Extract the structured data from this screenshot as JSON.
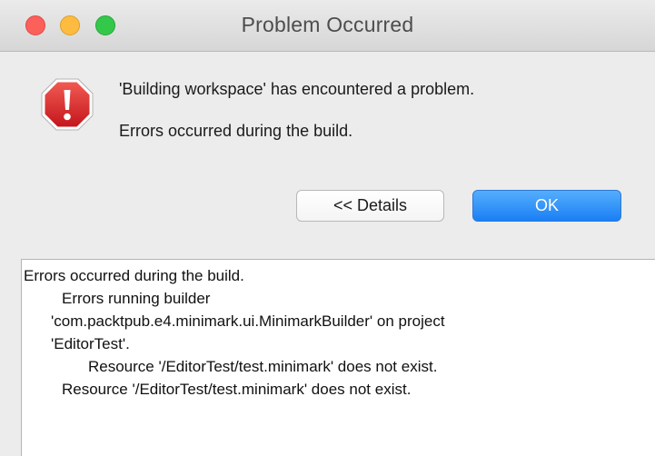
{
  "window": {
    "title": "Problem Occurred"
  },
  "colors": {
    "close": "#fc605b",
    "minimize": "#fdbc40",
    "zoom": "#34c84a",
    "accent": "#1a7ff5",
    "error_icon": "#d8232a"
  },
  "icons": {
    "alert": "error-octagon-exclamation"
  },
  "message": {
    "primary": "'Building workspace' has encountered a problem.",
    "secondary": "Errors occurred during the build."
  },
  "buttons": {
    "details_label": "<< Details",
    "ok_label": "OK"
  },
  "details": {
    "lines": [
      "Errors occurred during the build.",
      "Errors running builder",
      "'com.packtpub.e4.minimark.ui.MinimarkBuilder' on project",
      "'EditorTest'.",
      "Resource '/EditorTest/test.minimark' does not exist.",
      "Resource '/EditorTest/test.minimark' does not exist."
    ]
  }
}
